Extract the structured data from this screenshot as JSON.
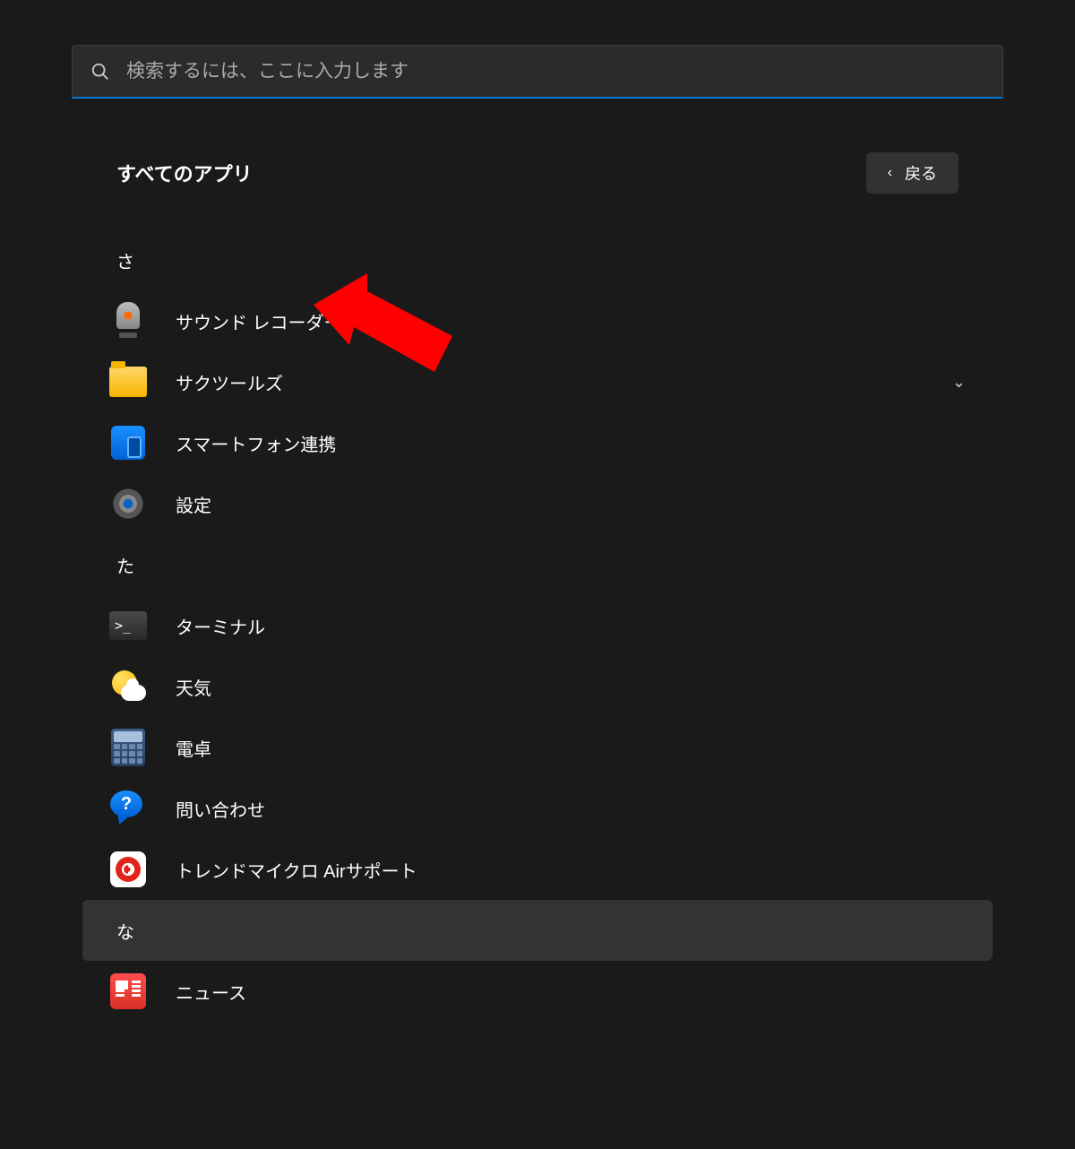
{
  "search": {
    "placeholder": "検索するには、ここに入力します"
  },
  "header": {
    "title": "すべてのアプリ",
    "back_label": "戻る"
  },
  "groups": {
    "sa": "さ",
    "ta": "た",
    "na": "な"
  },
  "apps": {
    "sound_recorder": "サウンド レコーダー",
    "saku_tools": "サクツールズ",
    "phone_link": "スマートフォン連携",
    "settings": "設定",
    "terminal": "ターミナル",
    "weather": "天気",
    "calculator": "電卓",
    "feedback": "問い合わせ",
    "trend_micro": "トレンドマイクロ Airサポート",
    "news": "ニュース"
  }
}
